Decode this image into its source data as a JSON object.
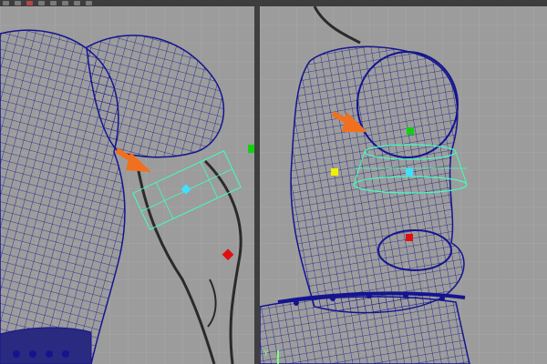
{
  "app": {
    "title": ""
  },
  "toolbar": {
    "buttons": [
      "tool",
      "tool",
      "tool",
      "tool",
      "tool",
      "tool",
      "tool",
      "tool"
    ]
  },
  "viewports": {
    "left": {
      "name": "perspective-view"
    },
    "right": {
      "name": "side-view",
      "axis_label": "Y"
    }
  },
  "colors": {
    "wireframe": "#141490",
    "arrow": "#f07020",
    "joint_red": "#e01010",
    "joint_green": "#10d010",
    "joint_yellow": "#f0f000",
    "pivot_cyan": "#40e0ff",
    "manipulator": "#40ffc0"
  }
}
